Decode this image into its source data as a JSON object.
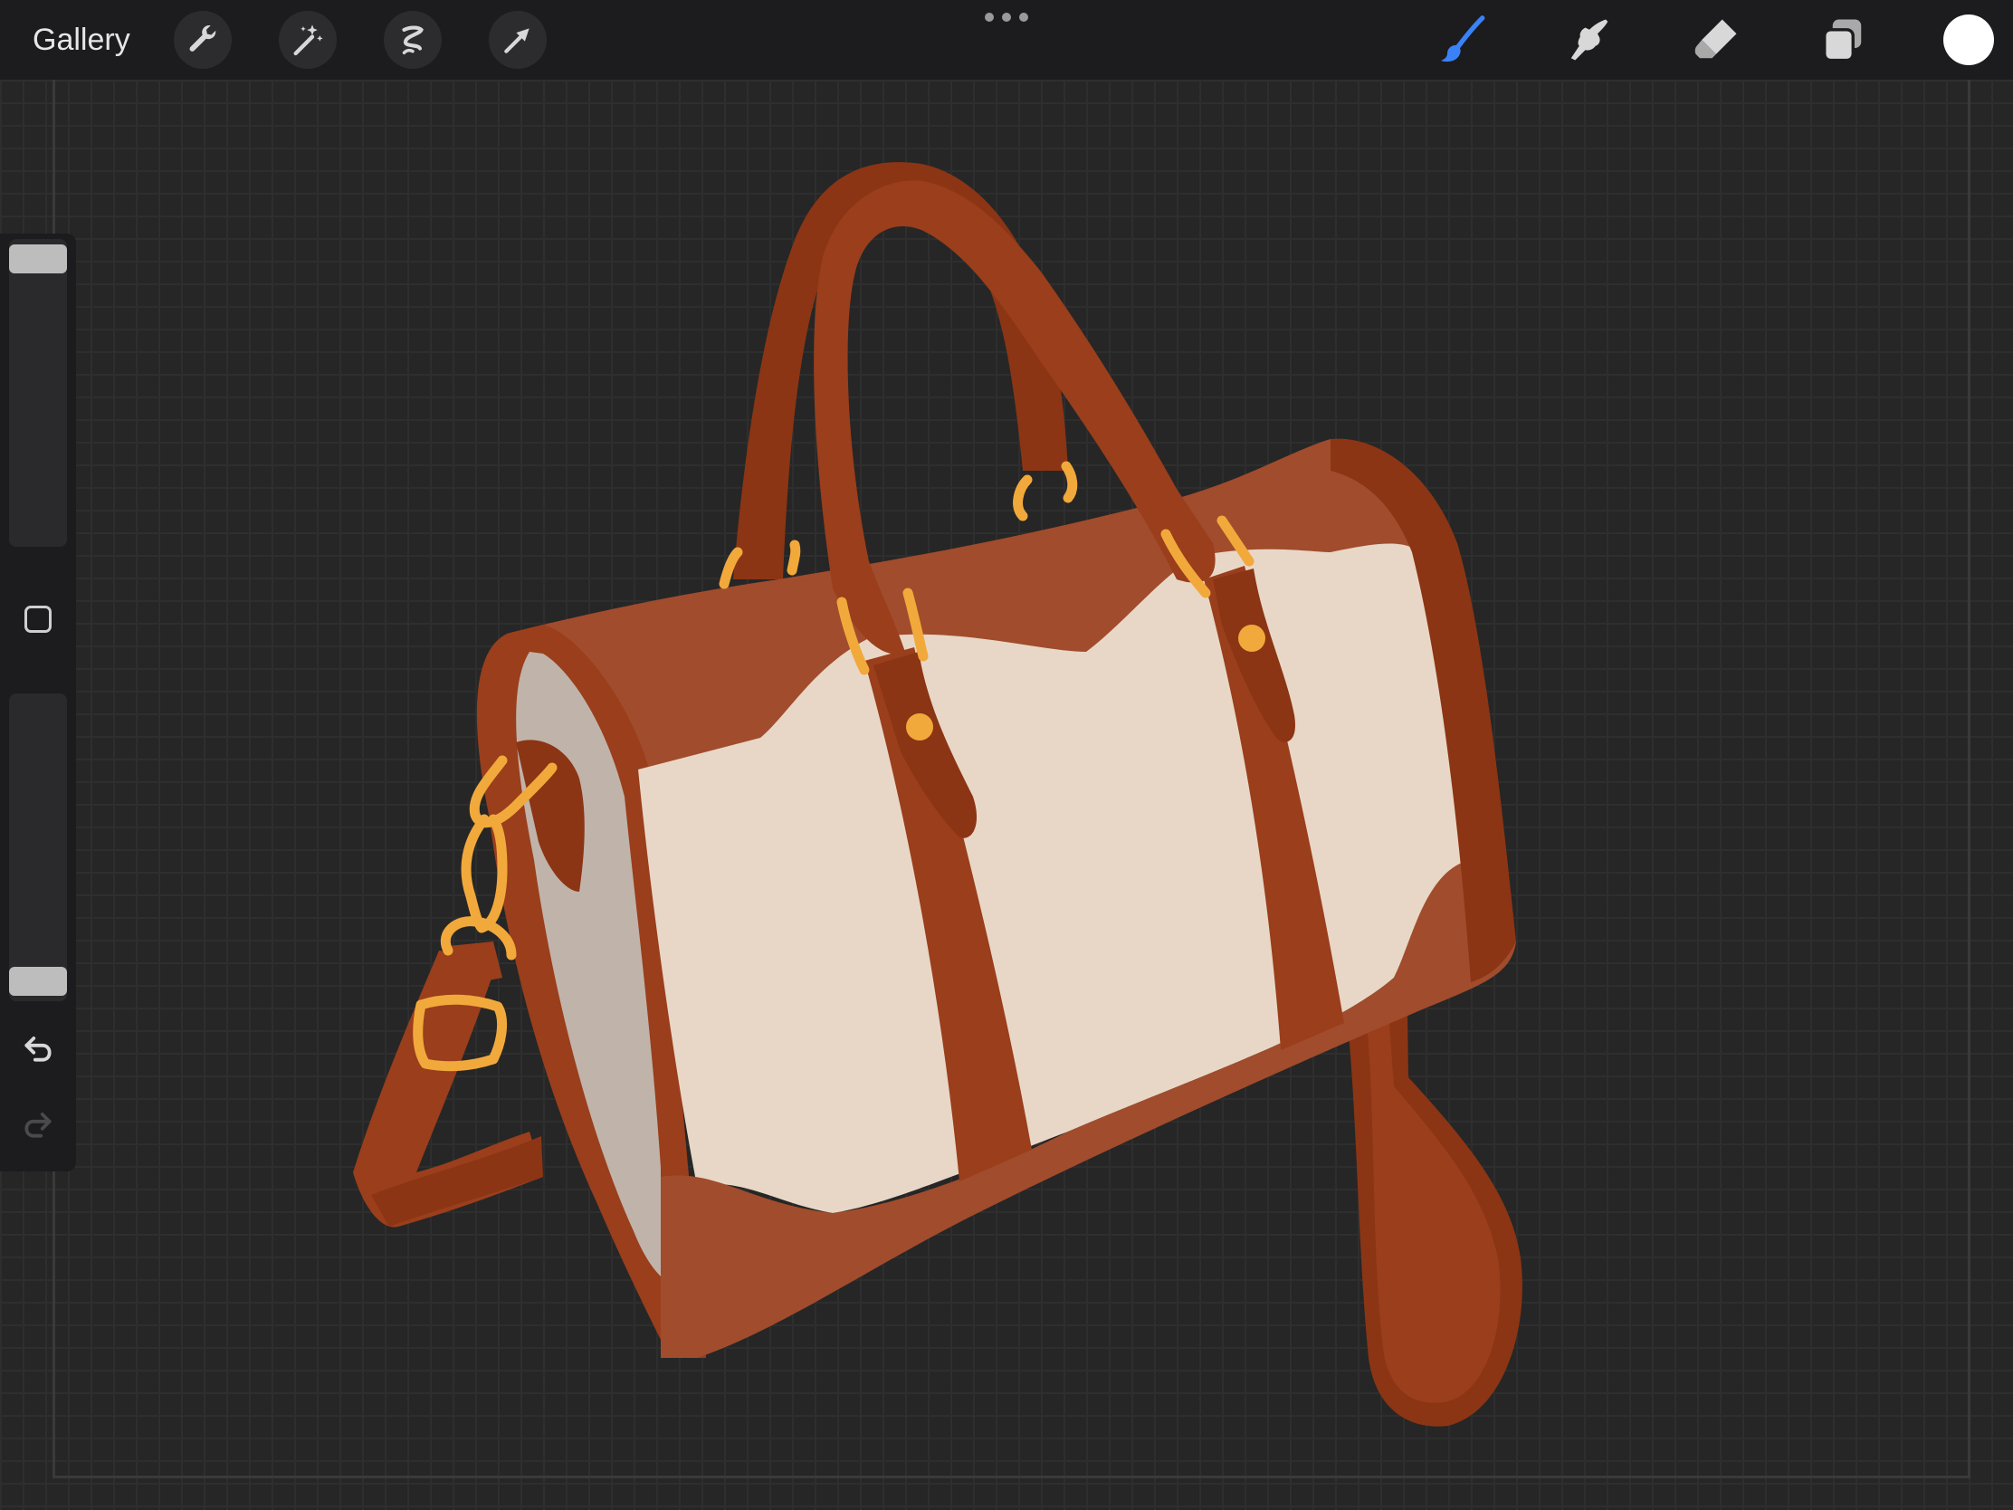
{
  "topbar": {
    "gallery_label": "Gallery",
    "left_tools": [
      "wrench-icon",
      "magic-wand-icon",
      "selection-icon",
      "transform-arrow-icon"
    ],
    "more_menu_icon": "ellipsis-icon",
    "right_tools": [
      "brush-icon",
      "smudge-icon",
      "eraser-icon",
      "layers-icon"
    ],
    "active_tool": "brush-icon",
    "active_color": "#3a82f7",
    "current_color": "#ffffff"
  },
  "sidebar": {
    "brush_size_level": 0.0,
    "brush_opacity_level": 1.0,
    "modify_icon": "square-icon",
    "undo_icon": "undo-icon",
    "redo_icon": "redo-icon",
    "redo_enabled": false
  },
  "canvas": {
    "background": "#262626",
    "artwork": "leather-duffel-bag-illustration",
    "palette": {
      "leather_dark": "#8b3514",
      "leather": "#9a3e1c",
      "leather_light": "#a14c2c",
      "canvas_cream": "#e8d7c6",
      "canvas_shade": "#c0b3aa",
      "hardware_gold": "#f2a93b"
    }
  }
}
